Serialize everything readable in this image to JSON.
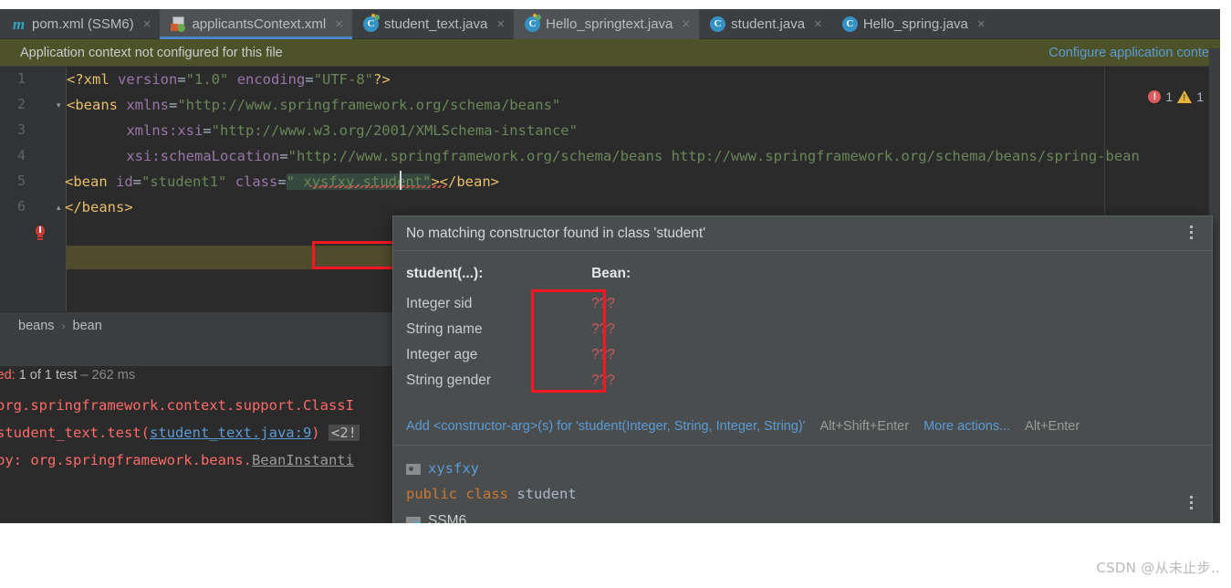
{
  "window": {
    "app": "IntelliJ IDEA"
  },
  "tabs": [
    {
      "label": "pom.xml (SSM6)",
      "icon": "maven-icon",
      "active": false,
      "close": "×"
    },
    {
      "label": "applicantsContext.xml",
      "icon": "spring-xml-icon",
      "active": true,
      "close": "×"
    },
    {
      "label": "student_text.java",
      "icon": "java-runnable-class-icon",
      "active": false,
      "close": "×"
    },
    {
      "label": "Hello_springtext.java",
      "icon": "java-runnable-class-icon",
      "active": false,
      "close": "×"
    },
    {
      "label": "student.java",
      "icon": "java-class-icon",
      "active": false,
      "close": "×"
    },
    {
      "label": "Hello_spring.java",
      "icon": "java-class-icon",
      "active": false,
      "close": "×"
    }
  ],
  "notification": {
    "message": "Application context not configured for this file",
    "action": "Configure application conte"
  },
  "editor": {
    "line_numbers": [
      "1",
      "2",
      "3",
      "4",
      "5",
      "6"
    ],
    "lines": [
      {
        "n": 1,
        "segments": [
          {
            "t": "<?xml ",
            "c": "pi"
          },
          {
            "t": "version",
            "c": "attr"
          },
          {
            "t": "=",
            "c": "plain"
          },
          {
            "t": "\"1.0\"",
            "c": "val"
          },
          {
            "t": " ",
            "c": "plain"
          },
          {
            "t": "encoding",
            "c": "attr"
          },
          {
            "t": "=",
            "c": "plain"
          },
          {
            "t": "\"UTF-8\"",
            "c": "val"
          },
          {
            "t": "?>",
            "c": "pi"
          }
        ]
      },
      {
        "n": 2,
        "segments": [
          {
            "t": "<beans ",
            "c": "tag"
          },
          {
            "t": "xmlns",
            "c": "attr"
          },
          {
            "t": "=",
            "c": "plain"
          },
          {
            "t": "\"http://www.springframework.org/schema/beans\"",
            "c": "val"
          }
        ]
      },
      {
        "n": 3,
        "segments": [
          {
            "t": "        xmlns:xsi",
            "c": "attr"
          },
          {
            "t": "=",
            "c": "plain"
          },
          {
            "t": "\"http://www.w3.org/2001/XMLSchema-instance\"",
            "c": "val"
          }
        ]
      },
      {
        "n": 4,
        "segments": [
          {
            "t": "        xsi:schemaLocation",
            "c": "attr"
          },
          {
            "t": "=",
            "c": "plain"
          },
          {
            "t": "\"http://www.springframework.org/schema/beans http://www.springframework.org/schema/beans/spring-bean",
            "c": "val"
          }
        ]
      },
      {
        "n": 5,
        "segments": [
          {
            "t": "<bean ",
            "c": "tag"
          },
          {
            "t": "id",
            "c": "attr"
          },
          {
            "t": "=",
            "c": "plain"
          },
          {
            "t": "\"student1\"",
            "c": "val"
          },
          {
            "t": " ",
            "c": "plain"
          },
          {
            "t": "class",
            "c": "attr"
          },
          {
            "t": "=",
            "c": "plain"
          },
          {
            "t": "\" xysfxy.student\"",
            "c": "val"
          },
          {
            "t": "></bean>",
            "c": "tag"
          }
        ]
      },
      {
        "n": 6,
        "segments": [
          {
            "t": "</beans>",
            "c": "tag"
          }
        ]
      }
    ],
    "error_count": "1",
    "warning_count": "1"
  },
  "breadcrumb": {
    "items": [
      "beans",
      "bean"
    ],
    "separator": "›"
  },
  "console": {
    "summary_failed": "ailed:",
    "summary_count": "1 of 1 test",
    "summary_time": "– 262 ms",
    "lines": [
      "org.springframework.context.support.ClassI",
      "student_text.test(student_text.java:9)",
      "by: org.springframework.beans.BeanInstanti"
    ],
    "link_text": "student_text.java:9",
    "chip_text": "<2!",
    "grey_text": "BeanInstanti"
  },
  "popup": {
    "title": "No matching constructor found in class 'student'",
    "col1_header": "student(...):",
    "col2_header": "Bean:",
    "params": [
      {
        "type_name": "Integer sid",
        "bean": "???"
      },
      {
        "type_name": "String name",
        "bean": "???"
      },
      {
        "type_name": "Integer age",
        "bean": "???"
      },
      {
        "type_name": "String gender",
        "bean": "???"
      }
    ],
    "action_primary": "Add <constructor-arg>(s) for 'student(Integer, String, Integer, String)'",
    "action_primary_key": "Alt+Shift+Enter",
    "action_more": "More actions...",
    "action_more_key": "Alt+Enter",
    "doc_package": "xysfxy",
    "doc_signature_kw": "public class",
    "doc_signature_name": "student",
    "doc_module": "SSM6",
    "menu_icon": "vertical-dots-icon"
  },
  "watermark": {
    "text": "CSDN @从未止步.."
  },
  "colors": {
    "accent_blue": "#4a88c7",
    "link_blue": "#5b9bd5",
    "error_red": "#ff6b68",
    "highlight_red": "#fa1722",
    "notify_olive": "#4e5228",
    "editor_bg": "#2b2b2b",
    "panel_bg": "#3c3f41",
    "popup_bg": "#4a4d4e"
  }
}
